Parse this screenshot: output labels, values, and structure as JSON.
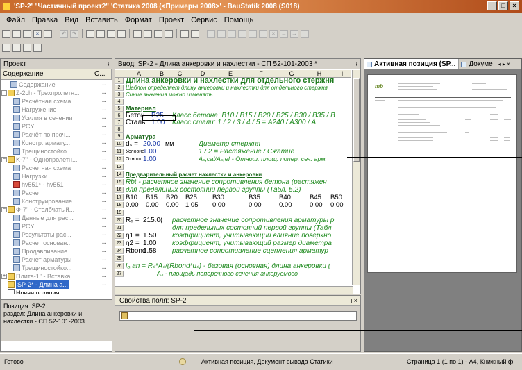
{
  "window": {
    "title": "'SP-2' \"Частичный проект2\" 'Статика 2008 (<Примеры 2008>' - BauStatik 2008 (S018)"
  },
  "menu": [
    "Файл",
    "Правка",
    "Вид",
    "Вставить",
    "Формат",
    "Проект",
    "Сервис",
    "Помощь"
  ],
  "left_panel": {
    "header": "Проект",
    "col_content": "Содержание",
    "col_c": "C...",
    "items": [
      {
        "label": "Содержание",
        "c": "--"
      },
      {
        "label": "Z-2ch - Трехпролетн...",
        "c": "--"
      },
      {
        "label": "Расчётная схема",
        "c": "--"
      },
      {
        "label": "Нагружение",
        "c": "--"
      },
      {
        "label": "Усилия в сечении",
        "c": "--"
      },
      {
        "label": "PCY",
        "c": "--"
      },
      {
        "label": "Расчёт по проч...",
        "c": "--"
      },
      {
        "label": "Констр. армату...",
        "c": "--"
      },
      {
        "label": "Трещиностойко...",
        "c": "--"
      },
      {
        "label": "K-7\" - Однопролетн...",
        "c": "--"
      },
      {
        "label": "Расчетная схема",
        "c": "--"
      },
      {
        "label": "Нагрузки",
        "c": "--"
      },
      {
        "label": "hv551* - hv551",
        "c": "--"
      },
      {
        "label": "Расчет",
        "c": "--"
      },
      {
        "label": "Конструирование",
        "c": "--"
      },
      {
        "label": "Ф-7\" - Столбчатый...",
        "c": "--"
      },
      {
        "label": "Данные для рас...",
        "c": "--"
      },
      {
        "label": "PCY",
        "c": "--"
      },
      {
        "label": "Результаты рас...",
        "c": "--"
      },
      {
        "label": "Расчет основан...",
        "c": "--"
      },
      {
        "label": "Продавливание",
        "c": "--"
      },
      {
        "label": "Расчет арматуры",
        "c": "--"
      },
      {
        "label": "Трещиностойко...",
        "c": "--"
      },
      {
        "label": "Плита-1\" - Вставка",
        "c": "--"
      },
      {
        "label": "SP-2* - Длина а...",
        "c": "--"
      },
      {
        "label": "Новая позиция...",
        "c": ""
      }
    ],
    "info": "Позиция: SP-2\nраздел: Длина анкеровки и нахлестки - СП 52-101-2003"
  },
  "editor": {
    "header": "Ввод: SP-2 - Длина анкеровки и нахлестки - СП 52-101-2003 *",
    "columns": [
      "A",
      "B",
      "C",
      "D",
      "E",
      "F",
      "G",
      "H",
      "I"
    ],
    "rows": [
      "1",
      "2",
      "3",
      "4",
      "5",
      "6",
      "7",
      "8",
      "9",
      "10",
      "11",
      "12",
      "13",
      "14",
      "15",
      "16",
      "17",
      "18",
      "19",
      "20",
      "21",
      "22",
      "23",
      "24",
      "25",
      "26",
      "27"
    ],
    "title": "Длина анкеровки и нахлестки для отдельного стержня",
    "subtitle": "Шаблон определяет длину анкеровки и нахлестки для отдельного стержня",
    "note": "Синие значения можно изменять.",
    "material": "Материал",
    "concrete_label": "Бетон",
    "concrete_val": "B25",
    "concrete_desc": "Класс бетона: B10 / B15 / B20 / B25 / B30 / B35 / B",
    "steel_label": "Сталь",
    "steel_val": "1.00",
    "steel_desc": "Класс стали: 1 / 2 / 3 / 4 / 5 = A240 / A300 / A",
    "armatura": "Арматура",
    "ds_label": "dₛ =",
    "ds_val": "20.00",
    "ds_unit": "мм",
    "ds_desc": "Диаметр стержня",
    "cond_label": "Условие",
    "cond_val": "1.00",
    "cond_desc": "1 / 2 = Растяжение / Сжатие",
    "otn_label": "Отнош.",
    "otn_val": "1.00",
    "otn_desc": "Aₛ,cal/Aₛ,ef - Отнош. площ. попер. сеч. арм.",
    "pre_title": "Предварительный расчет нахлестки и анкеровки",
    "rbt_desc1": "Rbt - расчетное значение сопротивления бетона (растяжен",
    "rbt_desc2": "для предельных состояний первой группы (Табл. 5.2)",
    "tbl_head": [
      "B10",
      "B15",
      "B20",
      "B25",
      "B30",
      "B35",
      "B40",
      "B45",
      "B50"
    ],
    "tbl_vals": [
      "0.00",
      "0.00",
      "0.00",
      "1.05",
      "0.00",
      "0.00",
      "0.00",
      "0.00",
      "0.00"
    ],
    "rs_label": "Rₛ =",
    "rs_val": "215.0(",
    "rs_desc1": "расчетное значение сопротивления арматуры р",
    "rs_desc2": "для предельных состояний первой группы (Табл",
    "n1_label": "η1 =",
    "n1_val": "1.50",
    "n1_desc": "коэффициент, учитывающий влияние поверхно",
    "n2_label": "η2 =",
    "n2_val": "1.00",
    "n2_desc": "коэффициент, учитывающий размер диаметра",
    "rbond_label": "Rbond",
    "rbond_val": "1.58",
    "rbond_desc": "расчетное сопротивление сцепления арматур",
    "l0_desc": "l₀,an = Rₛ*Aₛ/(Rbond*uₛ) - базовая (основная) длина анкеровки (",
    "l0_desc2": "Aₛ - площадь поперечного сечения анкеруемого"
  },
  "props": {
    "header": "Свойства поля: SP-2"
  },
  "right_panel": {
    "tab_active": "Активная позиция (SP...",
    "tab_other": "Докуме"
  },
  "status": {
    "ready": "Готово",
    "active": "Активная позиция, Документ вывода Статики",
    "page": "Страница 1 (1 по 1) - A4, Книжный ф"
  }
}
